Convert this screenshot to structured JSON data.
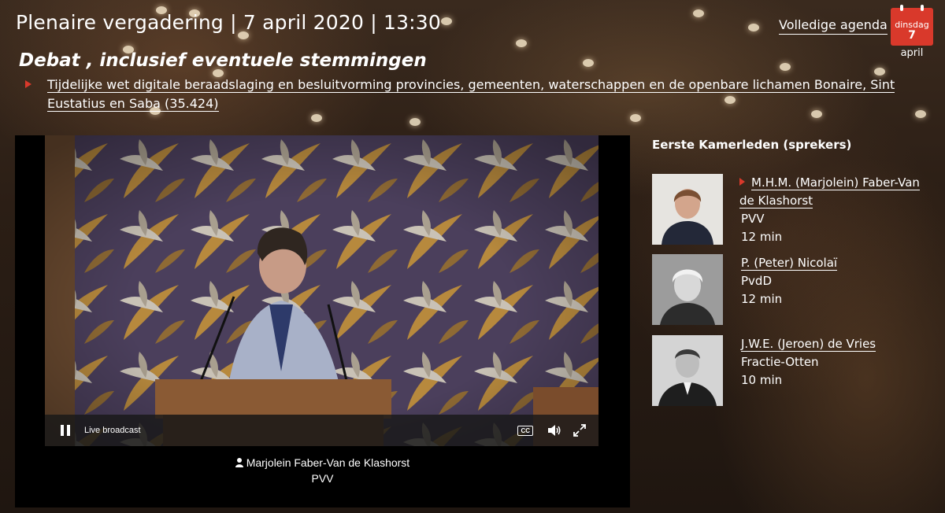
{
  "header": {
    "title": "Plenaire vergadering | 7 april 2020 | 13:30",
    "agenda_link": "Volledige agenda",
    "calendar": {
      "weekday": "dinsdag",
      "day": "7",
      "month": "april"
    }
  },
  "debate": {
    "title": "Debat , inclusief eventuele stemmingen",
    "item": "Tijdelijke wet digitale beraadslaging en besluitvorming provincies, gemeenten, waterschappen en de openbare lichamen Bonaire, Sint Eustatius en Saba (35.424)"
  },
  "player": {
    "live_label": "Live broadcast",
    "cc_label": "CC",
    "caption_name": "Marjolein Faber-Van de Klashorst",
    "caption_party": "PVV"
  },
  "speakers": {
    "heading": "Eerste Kamerleden (sprekers)",
    "list": [
      {
        "name": "M.H.M. (Marjolein) Faber-Van de Klashorst",
        "party": "PVV",
        "time": "12 min",
        "active": true
      },
      {
        "name": "P. (Peter) Nicolaï",
        "party": "PvdD",
        "time": "12 min",
        "active": false
      },
      {
        "name": "J.W.E. (Jeroen) de Vries",
        "party": "Fractie-Otten",
        "time": "10 min",
        "active": false
      }
    ]
  },
  "colors": {
    "accent": "#d9392b",
    "text": "#ffffff",
    "player_bg": "#000000"
  },
  "icons": [
    "calendar-icon",
    "pause-icon",
    "cc-icon",
    "volume-icon",
    "fullscreen-icon",
    "person-icon",
    "bullet-triangle-icon"
  ]
}
